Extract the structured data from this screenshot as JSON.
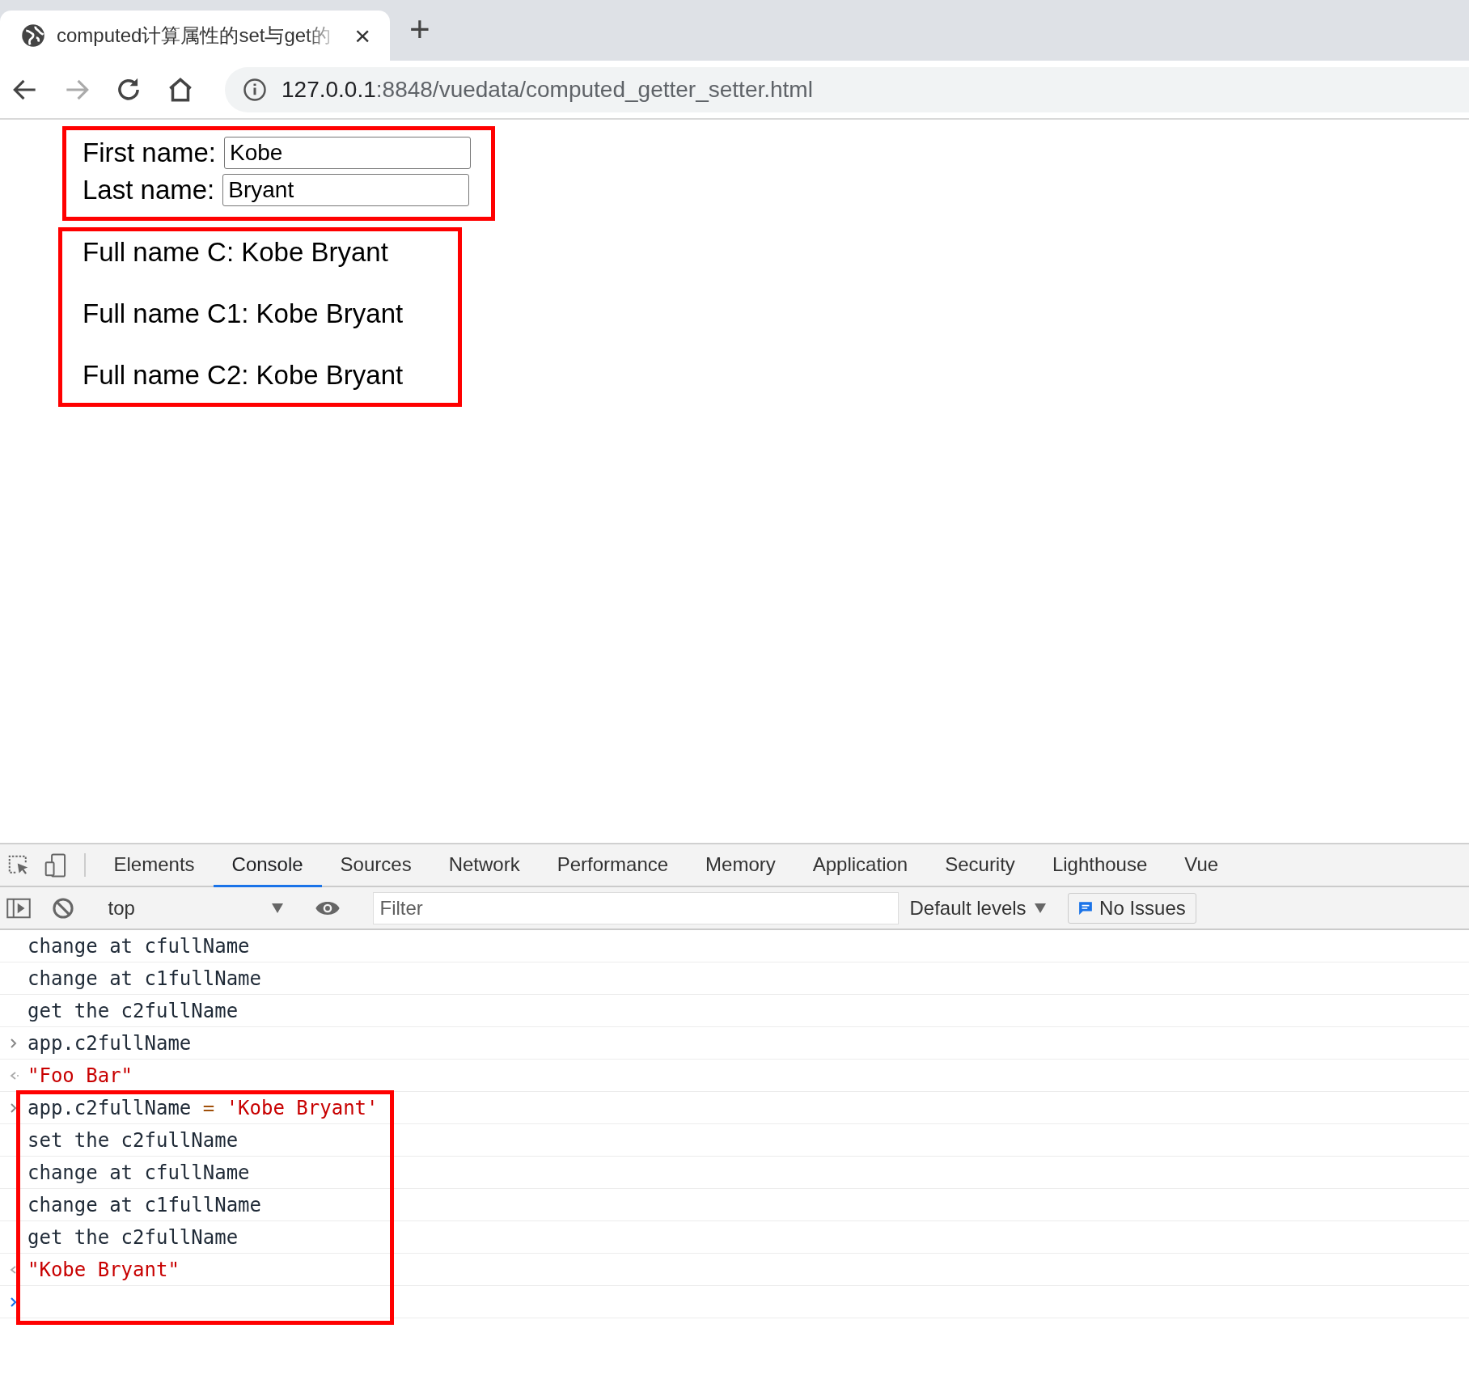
{
  "browser_tab": {
    "title": "computed计算属性的set与get的",
    "close": "×"
  },
  "new_tab": "+",
  "address_bar": {
    "host": "127.0.0.1",
    "path": ":8848/vuedata/computed_getter_setter.html"
  },
  "form": {
    "fields": [
      {
        "label": "First name:",
        "value": "Kobe"
      },
      {
        "label": "Last name:",
        "value": "Bryant"
      }
    ]
  },
  "outputs": [
    "Full name C: Kobe Bryant",
    "Full name C1: Kobe Bryant",
    "Full name C2: Kobe Bryant"
  ],
  "devtools": {
    "tabs": [
      {
        "label": "Elements",
        "selected": false
      },
      {
        "label": "Console",
        "selected": true
      },
      {
        "label": "Sources",
        "selected": false
      },
      {
        "label": "Network",
        "selected": false
      },
      {
        "label": "Performance",
        "selected": false
      },
      {
        "label": "Memory",
        "selected": false
      },
      {
        "label": "Application",
        "selected": false
      },
      {
        "label": "Security",
        "selected": false
      },
      {
        "label": "Lighthouse",
        "selected": false
      },
      {
        "label": "Vue",
        "selected": false
      }
    ],
    "context": "top",
    "filter": {
      "placeholder": "Filter"
    },
    "levels": "Default levels",
    "issues": "No Issues"
  },
  "console": {
    "entries": [
      {
        "kind": "log",
        "text": "change at cfullName"
      },
      {
        "kind": "log",
        "text": "change at c1fullName"
      },
      {
        "kind": "log",
        "text": "get the c2fullName"
      },
      {
        "kind": "input",
        "parts": [
          {
            "kind": "plain",
            "text": "app.c2fullName"
          }
        ]
      },
      {
        "kind": "result",
        "text": "\"Foo Bar\""
      }
    ],
    "highlighted_entries": [
      {
        "kind": "input",
        "parts": [
          {
            "kind": "plain",
            "text": "app.c2fullName"
          },
          {
            "kind": "operator",
            "text": "="
          },
          {
            "kind": "string",
            "text": "'Kobe Bryant'"
          }
        ]
      },
      {
        "kind": "log",
        "text": "set the c2fullName"
      },
      {
        "kind": "log",
        "text": "change at cfullName"
      },
      {
        "kind": "log",
        "text": "change at c1fullName"
      },
      {
        "kind": "log",
        "text": "get the c2fullName"
      },
      {
        "kind": "result",
        "text": "\"Kobe Bryant\""
      },
      {
        "kind": "prompt"
      }
    ]
  }
}
